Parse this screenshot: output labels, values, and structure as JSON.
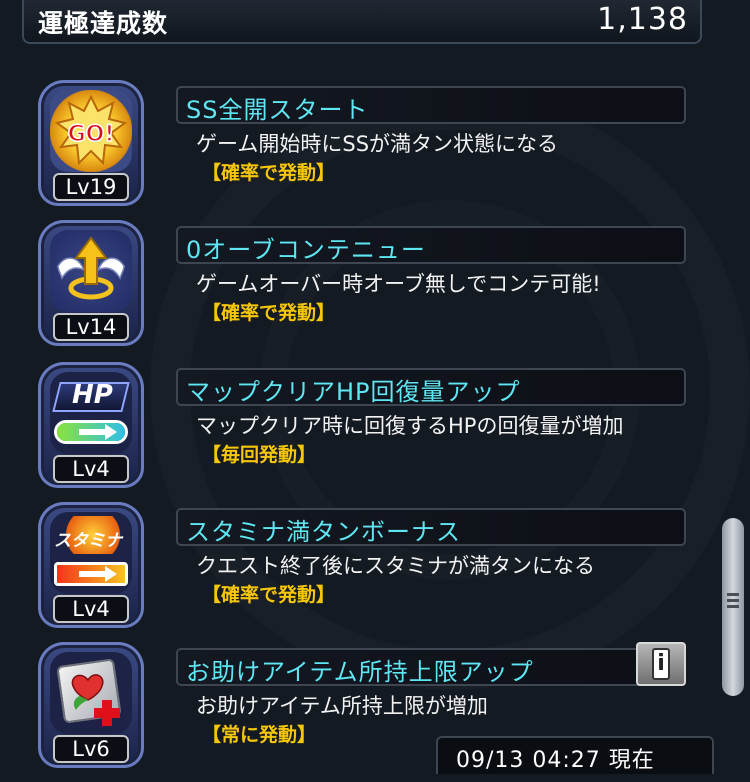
{
  "header": {
    "title": "運極達成数",
    "value": "1,138"
  },
  "abilities": [
    {
      "name": "SS全開スタート",
      "description": "ゲーム開始時にSSが満タン状態になる",
      "trigger": "【確率で発動】",
      "level": "Lv19",
      "icon": "go-burst-icon"
    },
    {
      "name": "0オーブコンテニュー",
      "description": "ゲームオーバー時オーブ無しでコンテ可能!",
      "trigger": "【確率で発動】",
      "level": "Lv14",
      "icon": "winged-arrow-icon"
    },
    {
      "name": "マップクリアHP回復量アップ",
      "description": "マップクリア時に回復するHPの回復量が増加",
      "trigger": "【毎回発動】",
      "level": "Lv4",
      "icon": "hp-gauge-icon",
      "icon_label": "HP"
    },
    {
      "name": "スタミナ満タンボーナス",
      "description": "クエスト終了後にスタミナが満タンになる",
      "trigger": "【確率で発動】",
      "level": "Lv4",
      "icon": "stamina-gauge-icon",
      "icon_label": "スタミナ"
    },
    {
      "name": "お助けアイテム所持上限アップ",
      "description": "お助けアイテム所持上限が増加",
      "trigger": "【常に発動】",
      "level": "Lv6",
      "icon": "item-box-plus-icon"
    }
  ],
  "info_button": {
    "icon": "info-icon",
    "label": "i"
  },
  "footer": {
    "timestamp": "09/13 04:27 現在"
  },
  "colors": {
    "name": "#5ee6f2",
    "trigger": "#f5c60a",
    "background": "#141a22"
  }
}
